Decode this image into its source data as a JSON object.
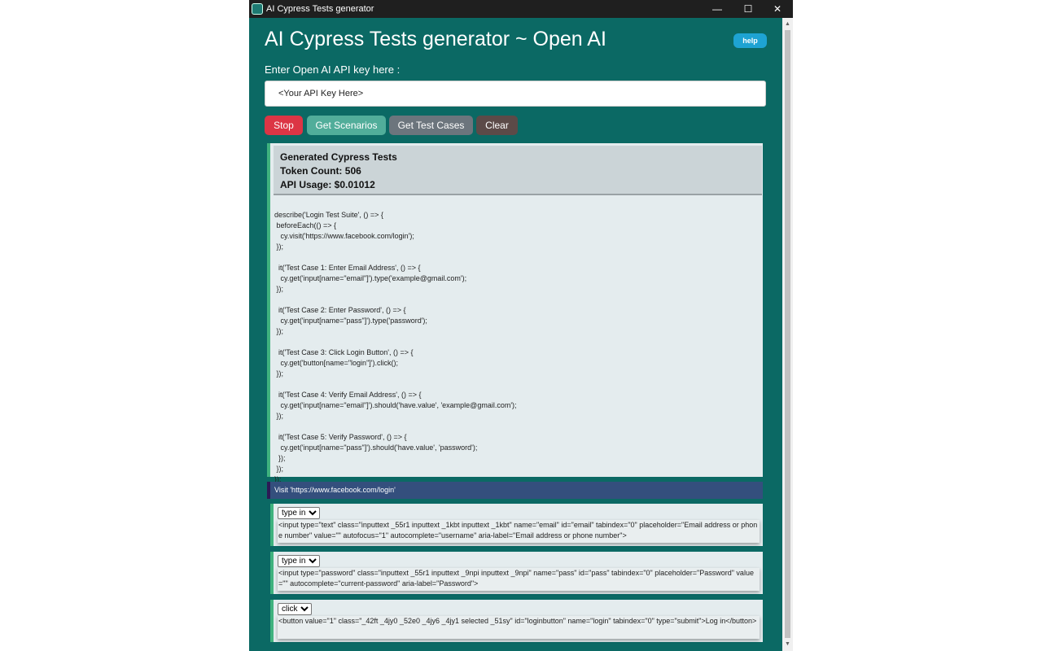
{
  "window": {
    "title": "AI Cypress Tests generator",
    "controls": {
      "minimize": "—",
      "maximize": "☐",
      "close": "✕"
    }
  },
  "header": {
    "title": "AI Cypress Tests generator ~ Open AI",
    "help_label": "help"
  },
  "api": {
    "label": "Enter Open AI API key here :",
    "value": "<Your API Key Here>"
  },
  "toolbar": {
    "stop_label": "Stop",
    "scenarios_label": "Get Scenarios",
    "test_cases_label": "Get Test Cases",
    "clear_label": "Clear"
  },
  "result": {
    "heading": "Generated Cypress Tests",
    "token_count": "Token Count: 506",
    "api_usage": "API Usage: $0.01012",
    "code": "describe('Login Test Suite', () => {\n beforeEach(() => {\n   cy.visit('https://www.facebook.com/login');\n });\n\n  it('Test Case 1: Enter Email Address', () => {\n   cy.get('input[name=\"email\"]').type('example@gmail.com');\n });\n\n  it('Test Case 2: Enter Password', () => {\n   cy.get('input[name=\"pass\"]').type('password');\n });\n\n  it('Test Case 3: Click Login Button', () => {\n   cy.get('button[name=\"login\"]').click();\n });\n\n  it('Test Case 4: Verify Email Address', () => {\n   cy.get('input[name=\"email\"]').should('have.value', 'example@gmail.com');\n });\n\n  it('Test Case 5: Verify Password', () => {\n   cy.get('input[name=\"pass\"]').should('have.value', 'password');\n  });\n });\n});"
  },
  "visit_step": "Visit 'https://www.facebook.com/login'",
  "steps": [
    {
      "action": "type in",
      "html": "<input type=\"text\" class=\"inputtext _55r1 inputtext _1kbt inputtext _1kbt\" name=\"email\" id=\"email\" tabindex=\"0\" placeholder=\"Email address or phone number\" value=\"\" autofocus=\"1\" autocomplete=\"username\" aria-label=\"Email address or phone number\">"
    },
    {
      "action": "type in",
      "html": "<input type=\"password\" class=\"inputtext _55r1 inputtext _9npi inputtext _9npi\" name=\"pass\" id=\"pass\" tabindex=\"0\" placeholder=\"Password\" value=\"\" autocomplete=\"current-password\" aria-label=\"Password\">"
    },
    {
      "action": "click",
      "html": "<button value=\"1\" class=\"_42ft _4jy0 _52e0 _4jy6 _4jy1 selected _51sy\" id=\"loginbutton\" name=\"login\" tabindex=\"0\" type=\"submit\">Log in</button>"
    }
  ],
  "icons": {
    "app": "app-logo-icon",
    "scroll_up": "scroll-up-arrow-icon",
    "scroll_down": "scroll-down-arrow-icon"
  },
  "colors": {
    "background": "#0b6964",
    "stop": "#dc3545",
    "scenarios": "#51ad9a",
    "test_cases": "#6c757d",
    "clear": "#5c4a48",
    "help": "#1ea3d3",
    "visit_bar": "#344f7d",
    "accent_border": "#3fb27e"
  }
}
